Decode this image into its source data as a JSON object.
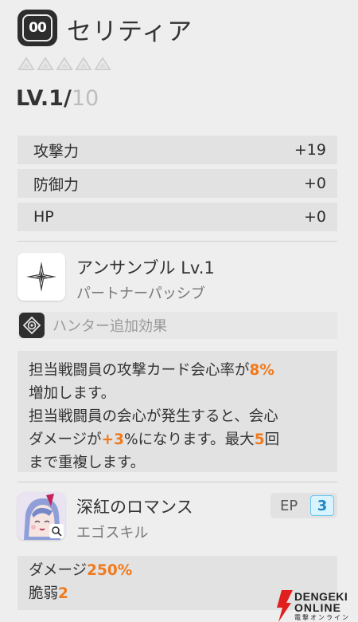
{
  "header": {
    "badge_text": "00",
    "title": "セリティア",
    "rarity_count": 5,
    "level_current": "LV.1/",
    "level_max": "10"
  },
  "stats": [
    {
      "label": "攻撃力",
      "value": "+19"
    },
    {
      "label": "防御力",
      "value": "+0"
    },
    {
      "label": "HP",
      "value": "+0"
    }
  ],
  "passive": {
    "name": "アンサンブル Lv.1",
    "type": "パートナーパッシブ",
    "hunter_label": "ハンター追加効果",
    "description": {
      "l1a": "担当戦闘員の攻撃カード会心率が",
      "l1b": "8%",
      "l2": "増加します。",
      "l3": "担当戦闘員の会心が発生すると、会心",
      "l4a": "ダメージが",
      "l4b": "+3",
      "l4c": "%になります。最大",
      "l4d": "5",
      "l4e": "回",
      "l5": "まで重複します。"
    }
  },
  "ego": {
    "name": "深紅のロマンス",
    "type": "エゴスキル",
    "ep_label": "EP",
    "ep_value": "3",
    "effect1_label": "ダメージ",
    "effect1_value": "250%",
    "effect2_label": "脆弱",
    "effect2_value": "2"
  },
  "watermark": {
    "line1": "DENGEKI",
    "line2": "ONLINE",
    "line3": "電撃オンライン"
  },
  "colors": {
    "accent_orange": "#f07a1e",
    "ep_blue": "#1f87c2"
  }
}
